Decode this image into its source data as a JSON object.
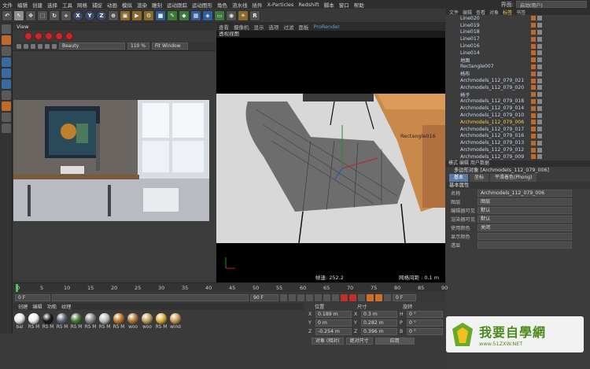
{
  "menu": [
    "文件",
    "编辑",
    "创建",
    "选择",
    "工具",
    "网格",
    "捕捉",
    "动画",
    "模拟",
    "渲染",
    "雕刻",
    "运动跟踪",
    "运动图形",
    "角色",
    "流水线",
    "插件",
    "X-Particles",
    "Redshift",
    "脚本",
    "窗口",
    "帮助"
  ],
  "menu_right": {
    "label": "界面:",
    "value": "启动(用户)"
  },
  "toolbar": {
    "xyz": [
      "X",
      "Y",
      "Z"
    ]
  },
  "view_left": {
    "title": "View",
    "render_mode": "Beauty",
    "zoom": "110 %",
    "fit": "Fit Window"
  },
  "view_main": {
    "tabs": [
      "查看",
      "摄像机",
      "显示",
      "选项",
      "过滤",
      "面板",
      "ProRender"
    ],
    "active_tab": "ProRender",
    "title": "透视视图",
    "object_label": "Rectangle016",
    "fps_label": "帧速: 252.2",
    "grid_label": "网格间距 : 0.1 m"
  },
  "object_manager": {
    "tabs": [
      "文件",
      "编辑",
      "查看",
      "对象",
      "标签",
      "书签"
    ],
    "rows": [
      "Line020",
      "Line019",
      "Line018",
      "Line017",
      "Line016",
      "Line014",
      "地面",
      "Rectangle007",
      "椅布",
      "Archmodels_112_079_021",
      "Archmodels_112_079_020",
      "椅子",
      "Archmodels_112_079_018",
      "Archmodels_112_079_014",
      "Archmodels_112_079_010",
      "Archmodels_112_079_006",
      "Archmodels_112_079_017",
      "Archmodels_112_079_016",
      "Archmodels_112_079_013",
      "Archmodels_112_079_012",
      "Archmodels_112_079_009"
    ],
    "selected": "Archmodels_112_079_006"
  },
  "attributes": {
    "mode_tabs": "模式  编辑  用户数据",
    "title": "多边形对象 [Archmodels_112_079_006]",
    "tabs": [
      "基本",
      "坐标",
      "平滑着色(Phong)"
    ],
    "section": "基本属性",
    "fields": [
      {
        "k": "名称",
        "v": "Archmodels_112_079_006"
      },
      {
        "k": "图层",
        "v": "图层"
      },
      {
        "k": "编辑器可见",
        "v": "默认"
      },
      {
        "k": "渲染器可见",
        "v": "默认"
      },
      {
        "k": "使用颜色",
        "v": "关闭"
      },
      {
        "k": "显示颜色",
        "v": ""
      },
      {
        "k": "透显",
        "v": ""
      }
    ]
  },
  "timeline": {
    "ticks": [
      "0",
      "5",
      "10",
      "15",
      "20",
      "25",
      "30",
      "35",
      "40",
      "45",
      "50",
      "55",
      "60",
      "65",
      "70",
      "75",
      "80",
      "85",
      "90"
    ],
    "current": "0 F",
    "start": "0 F",
    "end": "90 F",
    "end2": "90 F",
    "frame": "0 F"
  },
  "materials": {
    "tabs": [
      "创建",
      "编辑",
      "功能",
      "纹理"
    ],
    "items": [
      {
        "n": "bai",
        "c": "#e8e8e8"
      },
      {
        "n": "RS M",
        "c": "#f0f0f0"
      },
      {
        "n": "RS M",
        "c": "#1a1a1a"
      },
      {
        "n": "RS M",
        "c": "#5a6a7a"
      },
      {
        "n": "RS M",
        "c": "#4a7a3a"
      },
      {
        "n": "RS M",
        "c": "#8a8a8a"
      },
      {
        "n": "RS M",
        "c": "#c0c0c0"
      },
      {
        "n": "RS M",
        "c": "#c07a2a"
      },
      {
        "n": "woo",
        "c": "#b07a3a"
      },
      {
        "n": "woo",
        "c": "#c8a060"
      },
      {
        "n": "RS M",
        "c": "#d8b040"
      },
      {
        "n": "wind",
        "c": "#c89a5a"
      }
    ]
  },
  "coordinates": {
    "headers": [
      "位置",
      "尺寸",
      "旋转"
    ],
    "rows": [
      {
        "ax": "X",
        "p": "0.189 m",
        "ax2": "X",
        "s": "0.3 m",
        "ax3": "H",
        "r": "0 °"
      },
      {
        "ax": "Y",
        "p": "0 m",
        "ax2": "Y",
        "s": "0.282 m",
        "ax3": "P",
        "r": "0 °"
      },
      {
        "ax": "Z",
        "p": "-0.254 m",
        "ax2": "Z",
        "s": "0.396 m",
        "ax3": "B",
        "r": "0 °"
      }
    ],
    "mode1": "对象 (相对)",
    "mode2": "绝对尺寸",
    "apply": "应用"
  },
  "watermark": {
    "title": "我要自學網",
    "url": "www.51ZXW.NET"
  },
  "colors": {
    "accent": "#5aa0e0",
    "selected_text": "#ffcc33",
    "record": "#c0302a"
  }
}
